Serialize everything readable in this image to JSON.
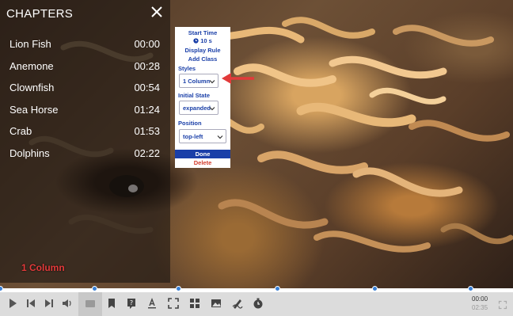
{
  "chapters": {
    "title": "CHAPTERS",
    "items": [
      {
        "name": "Lion Fish",
        "time": "00:00"
      },
      {
        "name": "Anemone",
        "time": "00:28"
      },
      {
        "name": "Clownfish",
        "time": "00:54"
      },
      {
        "name": "Sea Horse",
        "time": "01:24"
      },
      {
        "name": "Crab",
        "time": "01:53"
      },
      {
        "name": "Dolphins",
        "time": "02:22"
      }
    ]
  },
  "overlay_label": "1 Column",
  "panel": {
    "start_time_label": "Start Time",
    "start_time_value": "10 s",
    "display_rule": "Display Rule",
    "add_class": "Add Class",
    "styles_label": "Styles",
    "styles_value": "1 Column",
    "initial_state_label": "Initial State",
    "initial_state_value": "expanded",
    "position_label": "Position",
    "position_value": "top-left",
    "done": "Done",
    "delete": "Delete"
  },
  "player": {
    "current_time": "00:00",
    "duration": "02:35",
    "progress": 0
  },
  "colors": {
    "accent": "#1a3fa8",
    "danger": "#d23a2a",
    "marker": "#3a7fd4",
    "annotation_arrow": "#e23a3a"
  },
  "icons": [
    "play-icon",
    "skip-back-icon",
    "skip-forward-icon",
    "volume-icon",
    "captions-icon",
    "bookmark-icon",
    "quiz-icon",
    "text-icon",
    "crop-icon",
    "layout-icon",
    "image-icon",
    "draw-icon",
    "timer-icon",
    "fullscreen-icon"
  ]
}
